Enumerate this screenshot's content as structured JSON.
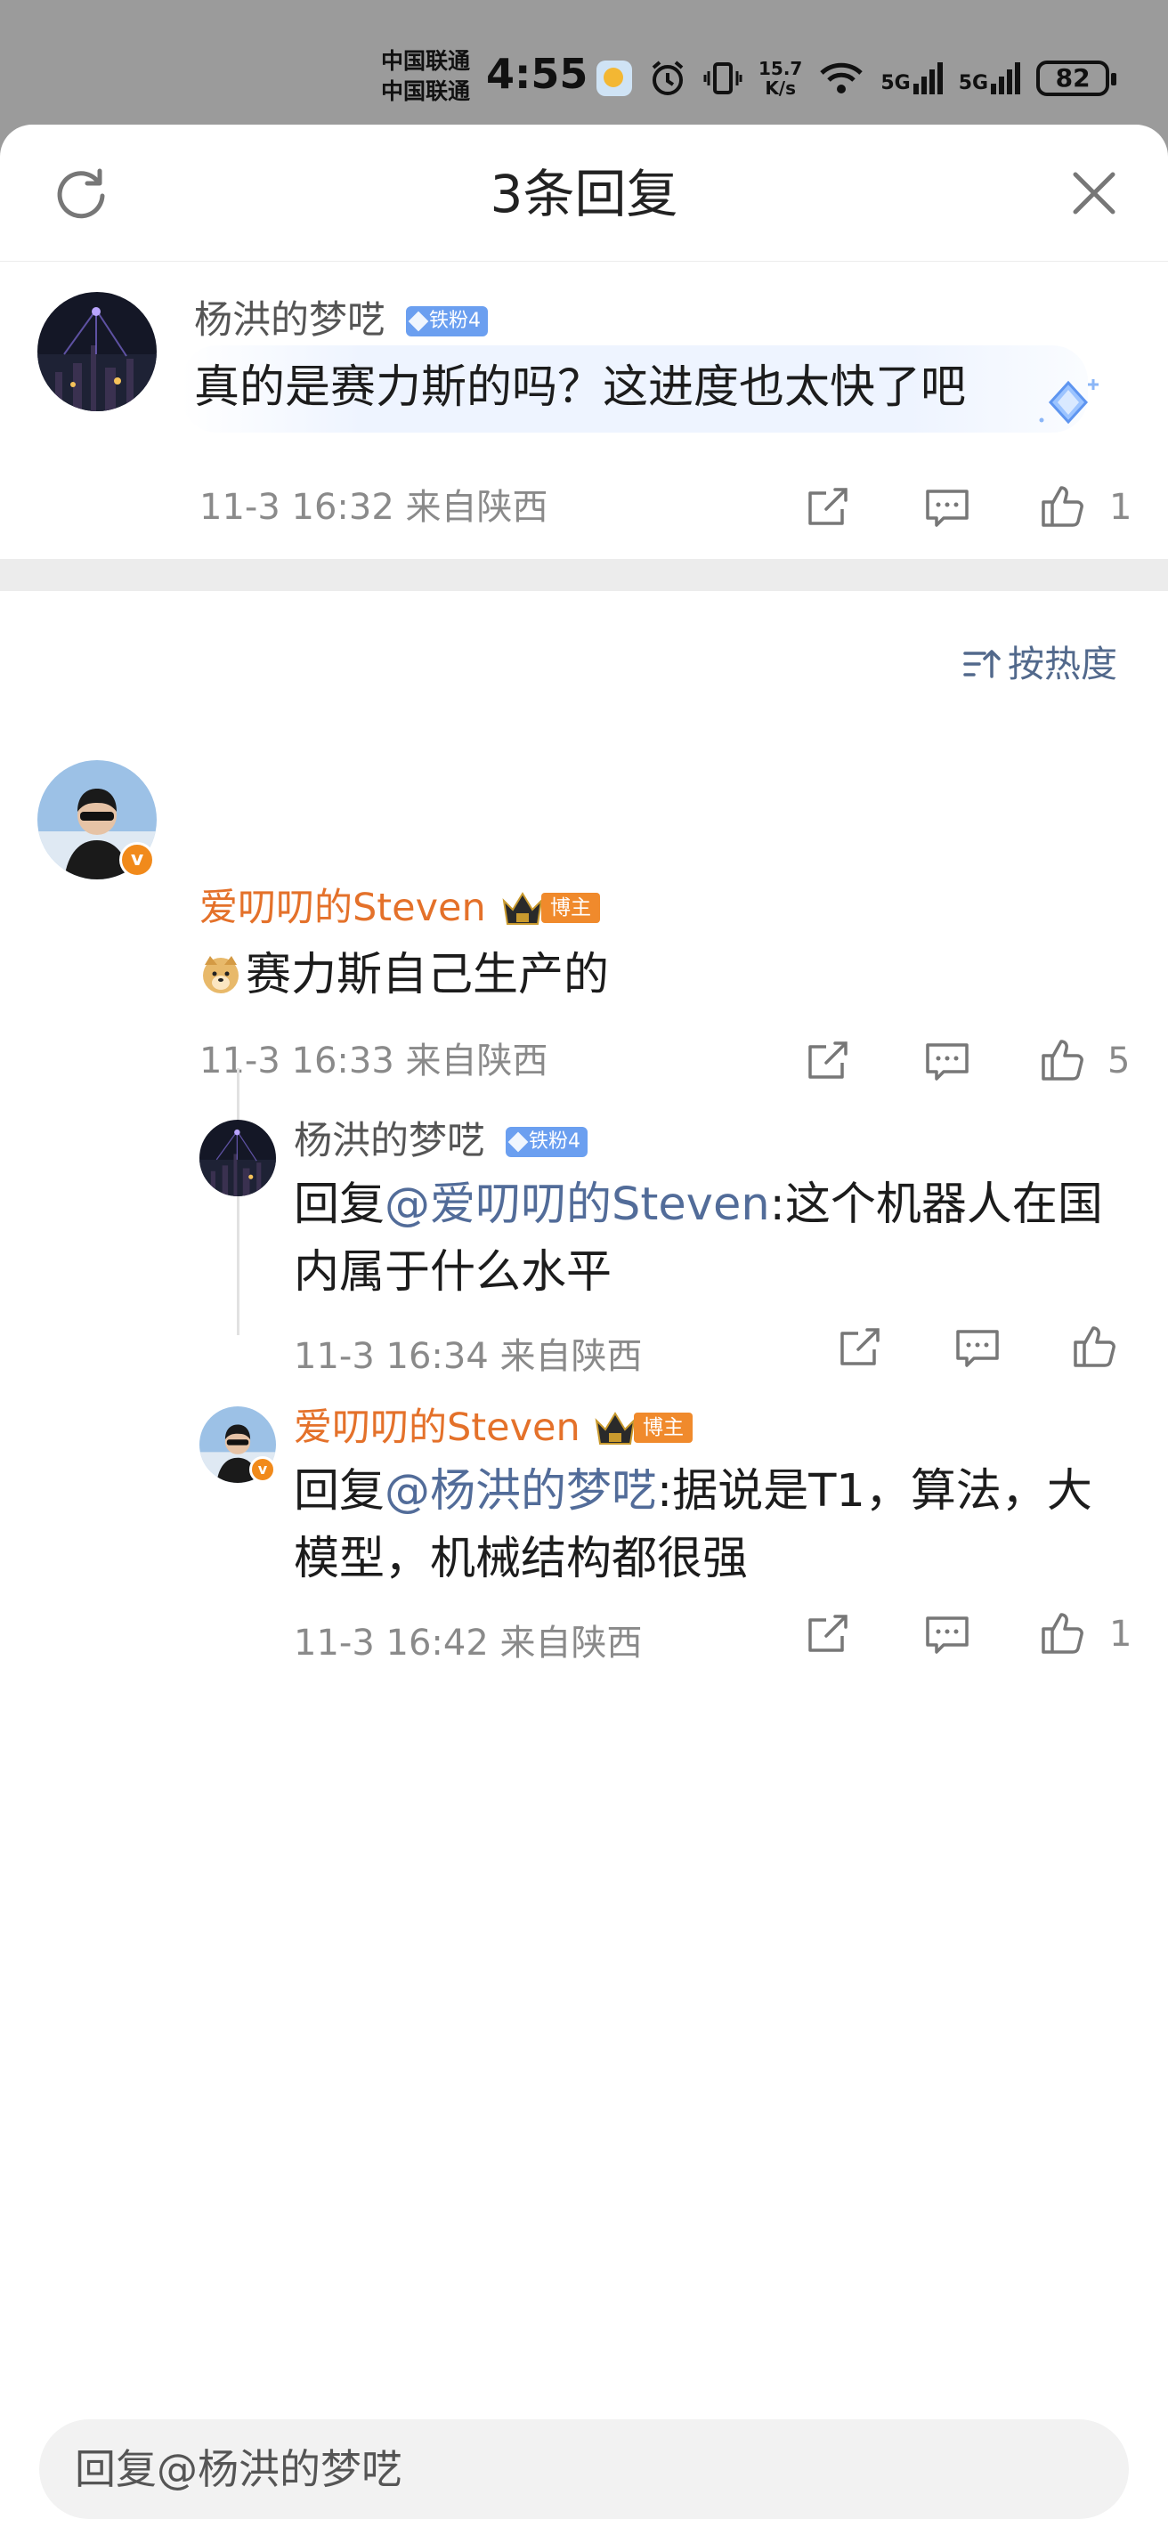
{
  "status_bar": {
    "carrier_1": "中国联通",
    "carrier_2": "中国联通",
    "time": "4:55",
    "net_speed_value": "15.7",
    "net_speed_unit": "K/s",
    "signal_1": "5G",
    "signal_2": "5G",
    "battery": "82"
  },
  "header": {
    "title": "3条回复",
    "refresh_icon": "refresh-icon",
    "close_icon": "close-icon"
  },
  "main_comment": {
    "username": "杨洪的梦呓",
    "badge": "铁粉4",
    "content": "真的是赛力斯的吗？这进度也太快了吧",
    "meta": "11-3 16:32  来自陕西",
    "like_count": "1"
  },
  "sort": {
    "label": "按热度"
  },
  "replies": [
    {
      "username": "爱叨叨的Steven",
      "badge": "博主",
      "content": "赛力斯自己生产的",
      "meta": "11-3 16:33  来自陕西",
      "like_count": "5"
    }
  ],
  "sub_replies": [
    {
      "username": "杨洪的梦呓",
      "badge": "铁粉4",
      "reply_prefix": "回复",
      "mention": "@爱叨叨的Steven",
      "content_line1": ":这个机器人在国",
      "content_line2": "内属于什么水平",
      "meta": "11-3 16:34  来自陕西",
      "like_count": ""
    },
    {
      "username": "爱叨叨的Steven",
      "badge": "博主",
      "reply_prefix": "回复",
      "mention": "@杨洪的梦呓",
      "content_line1": ":据说是T1，算法，大",
      "content_line2": "模型，机械结构都很强",
      "meta": "11-3 16:42  来自陕西",
      "like_count": "1"
    }
  ],
  "reply_input": {
    "placeholder": "回复@杨洪的梦呓"
  },
  "colors": {
    "accent_orange": "#e4712a",
    "mention_blue": "#526c99",
    "fan_badge_blue": "#6b9ff0",
    "blogger_badge_orange": "#f08a2c"
  }
}
